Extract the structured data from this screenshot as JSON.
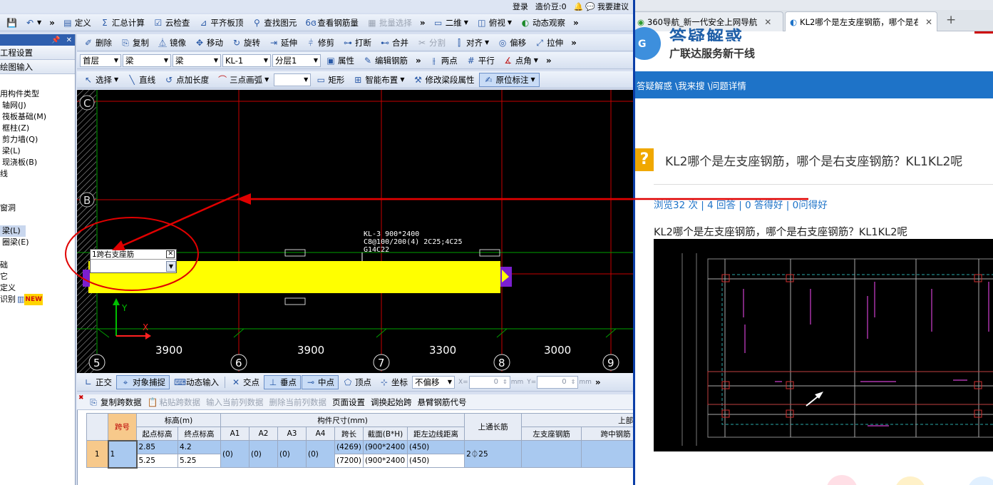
{
  "topstrip": {
    "login": "登录",
    "bean": "造价豆:0",
    "suggest": "我要建议"
  },
  "toolbar1": [
    "定义",
    "汇总计算",
    "云检查",
    "平齐板顶",
    "查找图元",
    "查看钢筋量",
    "批量选择",
    "二维",
    "俯视",
    "动态观察"
  ],
  "toolbar2": [
    "删除",
    "复制",
    "镜像",
    "移动",
    "旋转",
    "延伸",
    "修剪",
    "打断",
    "合并",
    "分割",
    "对齐",
    "偏移",
    "拉伸"
  ],
  "toolbar3": {
    "floor": "首层",
    "type1": "梁",
    "type2": "梁",
    "member": "KL-1",
    "layer": "分层1",
    "props": "属性",
    "edit_rebar": "编辑钢筋",
    "two_point": "两点",
    "parallel": "平行",
    "point_angle": "点角"
  },
  "toolbar4": [
    "选择",
    "直线",
    "点加长度",
    "三点画弧",
    "矩形",
    "智能布置",
    "修改梁段属性",
    "原位标注"
  ],
  "tree": {
    "items": [
      "工程设置",
      "绘图输入"
    ],
    "list": [
      "用构件类型",
      "轴网(J)",
      "筏板基础(M)",
      "框柱(Z)",
      "剪力墙(Q)",
      "梁(L)",
      "现浇板(B)",
      "线",
      "",
      "",
      "窗洞",
      "",
      "梁(L)",
      "圈梁(E)",
      "",
      "础",
      "它",
      "定义",
      "识别"
    ],
    "new_badge": "NEW"
  },
  "canvas": {
    "axis_letters": [
      "C",
      "B"
    ],
    "grid_numbers": [
      "5",
      "6",
      "7",
      "8",
      "9"
    ],
    "spans": [
      "3900",
      "3900",
      "3300",
      "3000"
    ],
    "beam_note": [
      "KL-3 900*2400",
      "C8@100/200(4) 2C25;4C25",
      "G14C22"
    ],
    "popup_title": "1跨右支座筋",
    "y_label": "Y",
    "x_label": "X"
  },
  "snapbar": [
    "正交",
    "对象捕捉",
    "动态输入",
    "交点",
    "垂点",
    "中点",
    "顶点",
    "坐标",
    "不偏移"
  ],
  "snapxy": {
    "x_label": "X=",
    "x_value": "0",
    "y_label": "Y=",
    "y_value": "0",
    "unit": "mm"
  },
  "gridtools": [
    "复制跨数据",
    "粘贴跨数据",
    "输入当前列数据",
    "删除当前列数据",
    "页面设置",
    "调换起始跨",
    "悬臂钢筋代号"
  ],
  "grid": {
    "headers": {
      "span_no": "跨号",
      "elevation": "标高(m)",
      "start_elev": "起点标高",
      "end_elev": "终点标高",
      "size": "构件尺寸(mm)",
      "a1": "A1",
      "a2": "A2",
      "a3": "A3",
      "a4": "A4",
      "span_len": "跨长",
      "section": "截面(B*H)",
      "dist": "距左边线距离",
      "top_through": "上通长筋",
      "top_rebar": "上部钢筋",
      "left_support": "左支座钢筋",
      "mid_span": "跨中钢筋"
    },
    "row": {
      "index": "1",
      "span": "1",
      "start1": "2.85",
      "end1": "4.2",
      "start2": "5.25",
      "end2": "5.25",
      "a1": "(0)",
      "a2": "(0)",
      "a3": "(0)",
      "a4": "(0)",
      "len1": "(4269)",
      "len2": "(7200)",
      "sec1": "(900*2400",
      "sec2": "(900*2400",
      "dist1": "(450)",
      "dist2": "(450)",
      "through": "2⏀25"
    }
  },
  "browser": {
    "tabs": [
      {
        "label": "360导航_新一代安全上网导航"
      },
      {
        "label": "KL2哪个是左支座钢筋，哪个是右"
      }
    ],
    "new_tab": "+",
    "logo_title": "答疑解惑",
    "logo_sub": "广联达服务新干线",
    "breadcrumb": "答疑解惑 \\我来搜 \\问题详情",
    "question_title": "KL2哪个是左支座钢筋，哪个是右支座钢筋？KL1KL2呢",
    "stats": "浏览32 次 | 4 回答 | 0 答得好 | 0问得好",
    "question_body": "KL2哪个是左支座钢筋，哪个是右支座钢筋？KL1KL2呢"
  },
  "colors": {
    "accent": "#1e73c8",
    "beam": "#ffff00",
    "grid_red": "#c80000",
    "grid_green": "#00a000",
    "annot_red": "#e00000"
  }
}
